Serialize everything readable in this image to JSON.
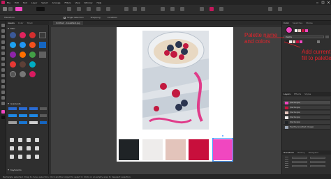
{
  "menubar": {
    "items": [
      "File",
      "Edit",
      "Text",
      "Layer",
      "Select",
      "Arrange",
      "Filters",
      "View",
      "Window",
      "Help"
    ]
  },
  "context_toolbar": {
    "items": [
      "Transform",
      "Single selection",
      "Snapping",
      "Constrain"
    ]
  },
  "assets_panel": {
    "tabs": [
      "Assets",
      "Color",
      "Stock"
    ],
    "sections": [
      "Misc",
      "Gradients",
      "Keyboards"
    ]
  },
  "document": {
    "tab_label": "Untitled - breakfast.jpg"
  },
  "swatches": [
    {
      "color": "#1f2326"
    },
    {
      "color": "#eeeceb"
    },
    {
      "color": "#e3c4bb"
    },
    {
      "color": "#c80f3c"
    },
    {
      "color": "#f047c0"
    }
  ],
  "right_panel": {
    "tabs": [
      "Color",
      "Swatches",
      "Stroke"
    ],
    "palette_name": "Palette",
    "layers_tabs": [
      "Layers",
      "Effects",
      "Styles"
    ],
    "layers": [
      {
        "name": "(Rectangle)",
        "color": "#f047c0",
        "selected": true
      },
      {
        "name": "(Rectangle)",
        "color": "#c80f3c"
      },
      {
        "name": "(Rectangle)",
        "color": "#e3c4bb"
      },
      {
        "name": "(Rectangle)",
        "color": "#eeeceb"
      },
      {
        "name": "(Rectangle)",
        "color": "#1f2326"
      },
      {
        "name": "Healthy breakfast (Image)",
        "color": "#9aa5b3"
      }
    ],
    "bottom_tabs": [
      "Transform",
      "History",
      "Navigator"
    ]
  },
  "annotations": {
    "palette_label": "Palette name\nand colors",
    "add_label": "Add current\nfill to palette"
  },
  "status": {
    "text": "Rectangle selected. Drag to move selection. Click another object to select it. Click on an empty area to deselect selection."
  },
  "colors": {
    "accent_pink": "#f047c0",
    "annotation_red": "#e5232b",
    "selection_blue": "#4a9eff"
  }
}
